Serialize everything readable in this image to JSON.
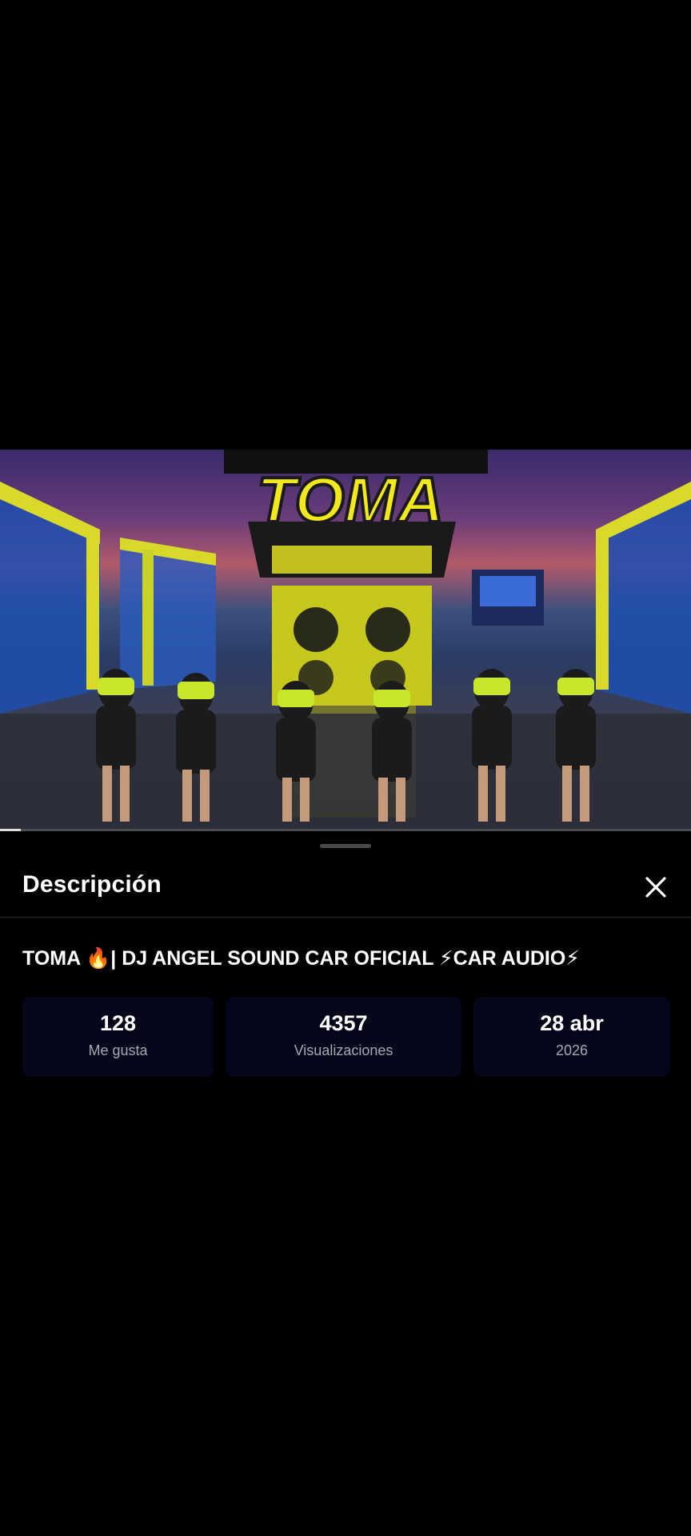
{
  "sheet": {
    "title": "Descripción",
    "close_icon": "close-icon"
  },
  "video": {
    "title": "TOMA 🔥| DJ ANGEL SOUND CAR OFICIAL ⚡CAR AUDIO⚡",
    "thumbnail_logo_text": "TOMA",
    "progress": 0.03
  },
  "stats": [
    {
      "value": "128",
      "label": "Me gusta"
    },
    {
      "value": "4357",
      "label": "Visualizaciones"
    },
    {
      "value": "28 abr",
      "label": "2026"
    }
  ]
}
